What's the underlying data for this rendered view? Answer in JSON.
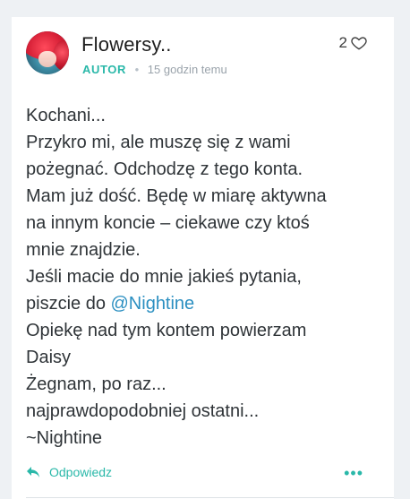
{
  "comment": {
    "author": "Flowersy..",
    "role": "AUTOR",
    "separator": "•",
    "time": "15 godzin temu",
    "likes": "2",
    "message": {
      "l1": "Kochani...",
      "l2": "Przykro mi, ale muszę się z wami",
      "l3": "pożegnać. Odchodzę z tego konta.",
      "l4": "Mam już dość. Będę w miarę aktywna",
      "l5": "na innym koncie – ciekawe czy ktoś",
      "l6": "mnie znajdzie.",
      "l7": "Jeśli macie do mnie jakieś pytania,",
      "l8_prefix": "piszcie do ",
      "l8_mention": "@Nightine",
      "l9": "Opiekę nad tym kontem powierzam",
      "l10": "Daisy",
      "l11": "Żegnam, po raz...",
      "l12": "najprawdopodobniej ostatni...",
      "l13": "~Nightine"
    },
    "reply_label": "Odpowiedz",
    "more_label": "•••"
  },
  "colors": {
    "accent": "#2ab8a9",
    "mention": "#2b8fc1",
    "text": "#2f3438",
    "meta": "#9aa3ab"
  },
  "icons": {
    "like": "heart-outline-icon",
    "reply": "reply-arrow-icon",
    "more": "more-dots-icon"
  }
}
